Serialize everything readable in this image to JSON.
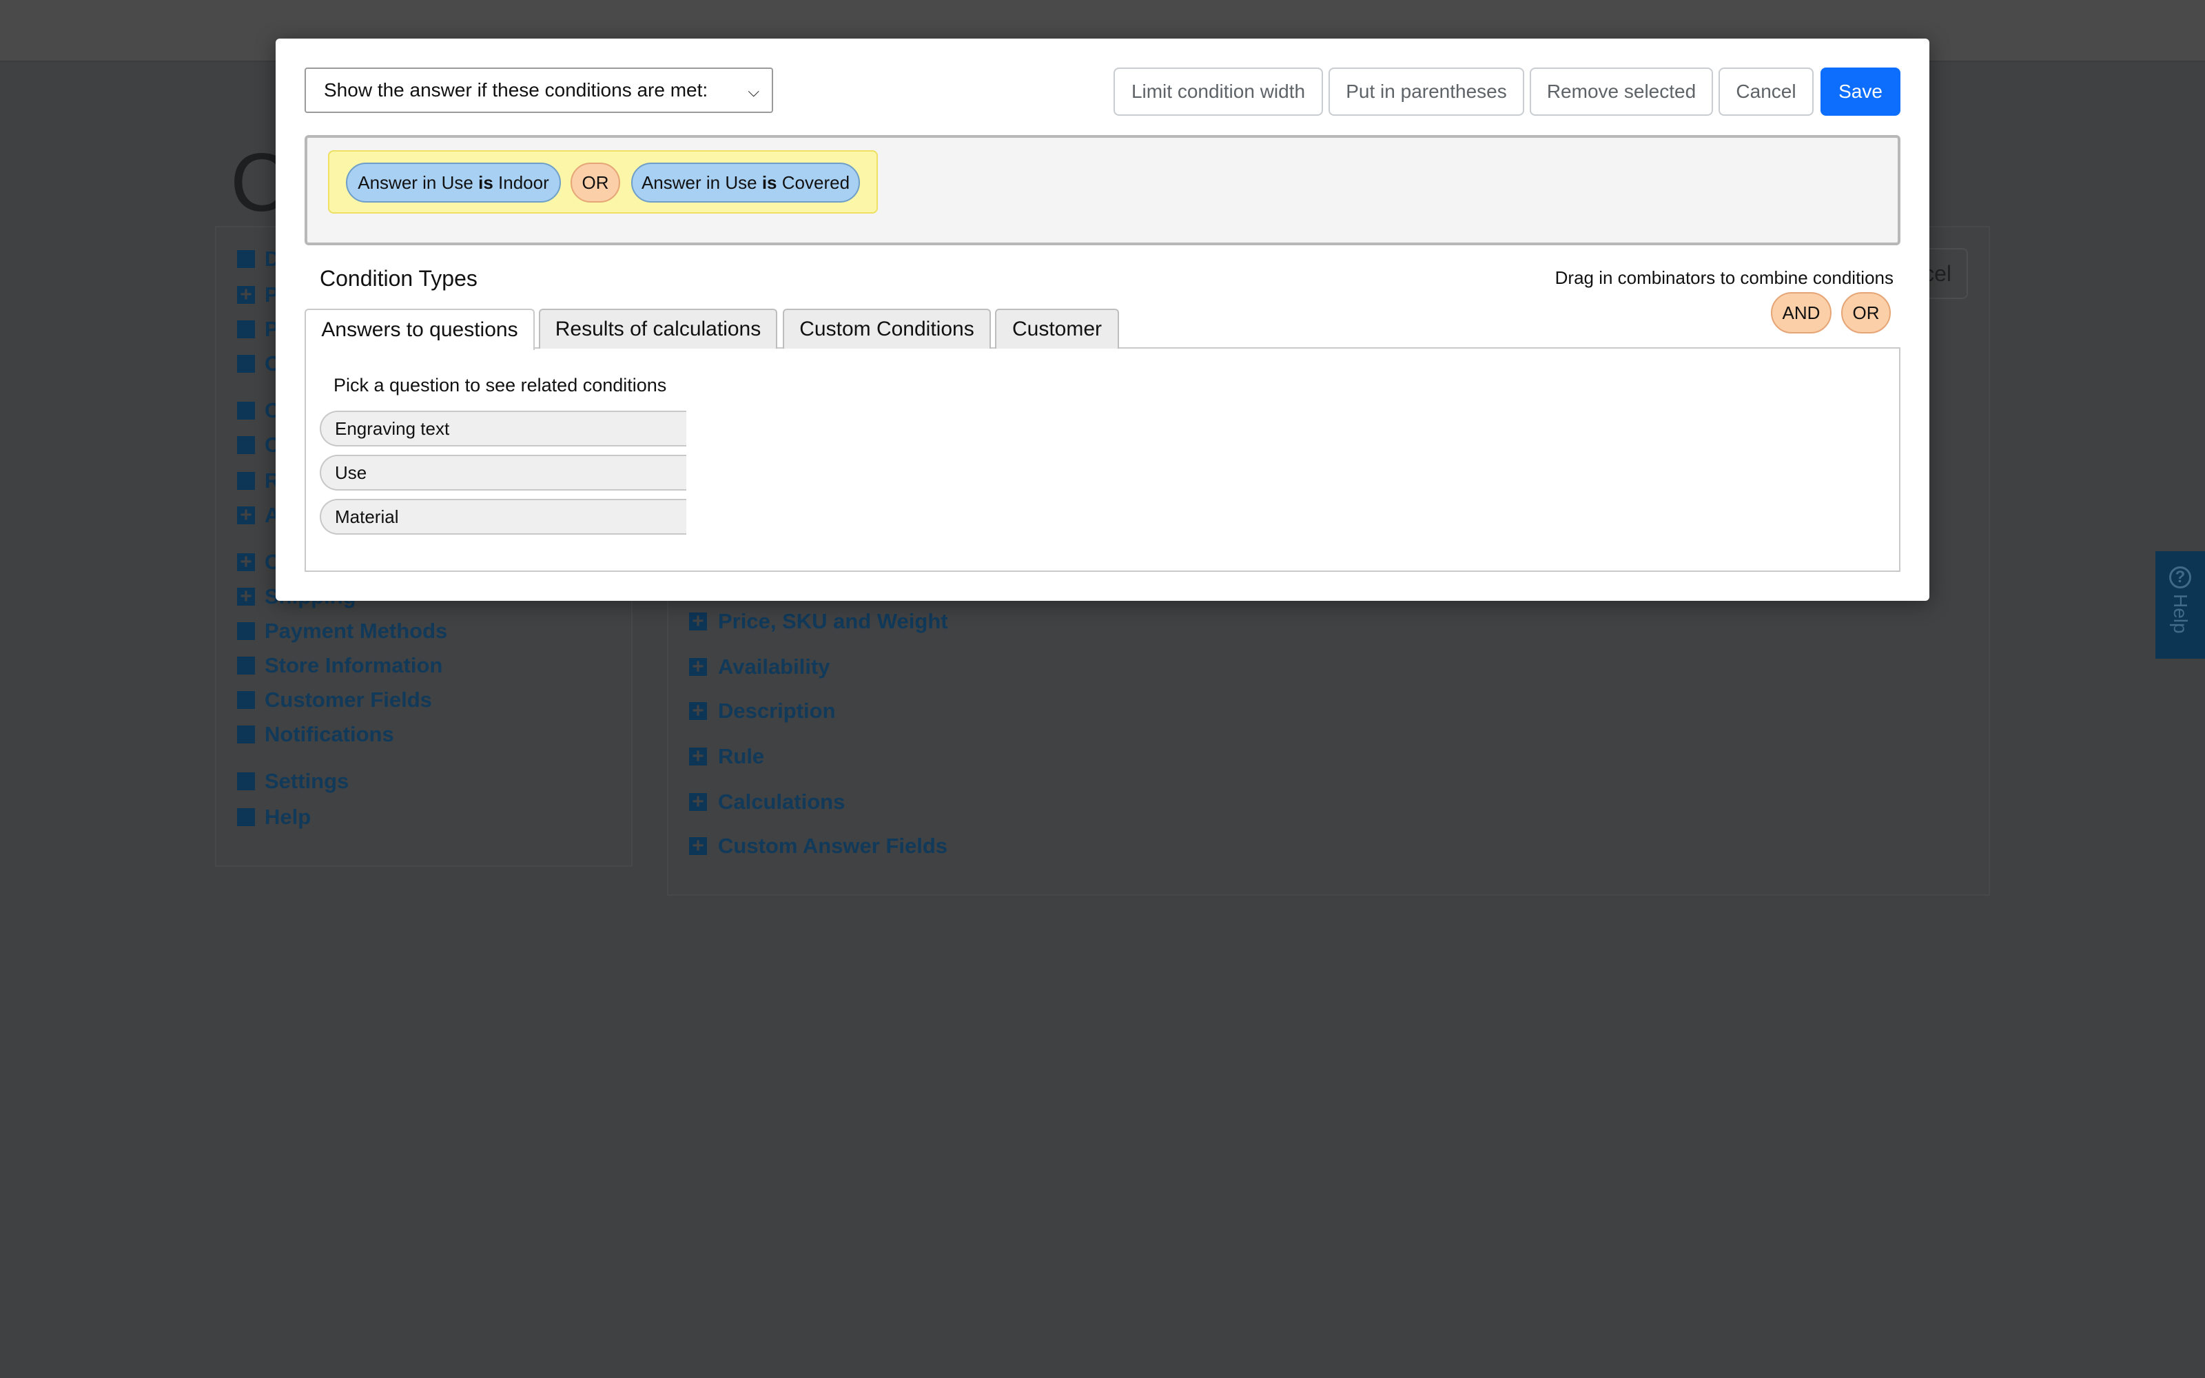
{
  "background": {
    "heading": "C",
    "sidebar": [
      {
        "label": "D",
        "icon": "square-icon"
      },
      {
        "label": "P",
        "icon": "plus-icon"
      },
      {
        "label": "P",
        "icon": "square-icon"
      },
      {
        "label": "O",
        "icon": "square-icon"
      },
      {
        "label": "C",
        "icon": "square-icon"
      },
      {
        "label": "C",
        "icon": "square-icon"
      },
      {
        "label": "R",
        "icon": "square-icon"
      },
      {
        "label": "A",
        "icon": "plus-icon"
      },
      {
        "label": "C",
        "icon": "plus-icon"
      },
      {
        "label": "Shipping",
        "icon": "plus-icon"
      },
      {
        "label": "Payment Methods",
        "icon": "square-icon"
      },
      {
        "label": "Store Information",
        "icon": "square-icon"
      },
      {
        "label": "Customer Fields",
        "icon": "square-icon"
      },
      {
        "label": "Notifications",
        "icon": "square-icon"
      },
      {
        "label": "Settings",
        "icon": "square-icon"
      },
      {
        "label": "Help",
        "icon": "square-icon"
      }
    ],
    "sections": [
      {
        "label": "Price, SKU and Weight"
      },
      {
        "label": "Availability"
      },
      {
        "label": "Description"
      },
      {
        "label": "Rule"
      },
      {
        "label": "Calculations"
      },
      {
        "label": "Custom Answer Fields"
      }
    ],
    "cancel_fragment": "cel",
    "help_tab": {
      "icon": "question-circle-icon",
      "label": "Help"
    }
  },
  "modal": {
    "mode_select": {
      "selected": "Show the answer if these conditions are met:"
    },
    "toolbar": {
      "limit_width": "Limit condition width",
      "parentheses": "Put in parentheses",
      "remove_selected": "Remove selected",
      "cancel": "Cancel",
      "save": "Save"
    },
    "expression": {
      "cond1": {
        "prefix": "Answer in Use",
        "op": "is",
        "value": "Indoor"
      },
      "combinator": "OR",
      "cond2": {
        "prefix": "Answer in Use",
        "op": "is",
        "value": "Covered"
      }
    },
    "condition_types_title": "Condition Types",
    "drag_hint": "Drag in combinators to combine conditions",
    "combinators": [
      "AND",
      "OR"
    ],
    "tabs": [
      {
        "label": "Answers to questions",
        "active": true
      },
      {
        "label": "Results of calculations",
        "active": false
      },
      {
        "label": "Custom Conditions",
        "active": false
      },
      {
        "label": "Customer",
        "active": false
      }
    ],
    "pick_label": "Pick a question to see related conditions",
    "questions": [
      "Engraving text",
      "Use",
      "Material"
    ]
  },
  "colors": {
    "accent": "#0d6efd",
    "condition_chip": "#a8d0f3",
    "combinator_chip": "#fbcfa8",
    "group_highlight": "#fbf6a8",
    "nav_text": "#10395a"
  }
}
